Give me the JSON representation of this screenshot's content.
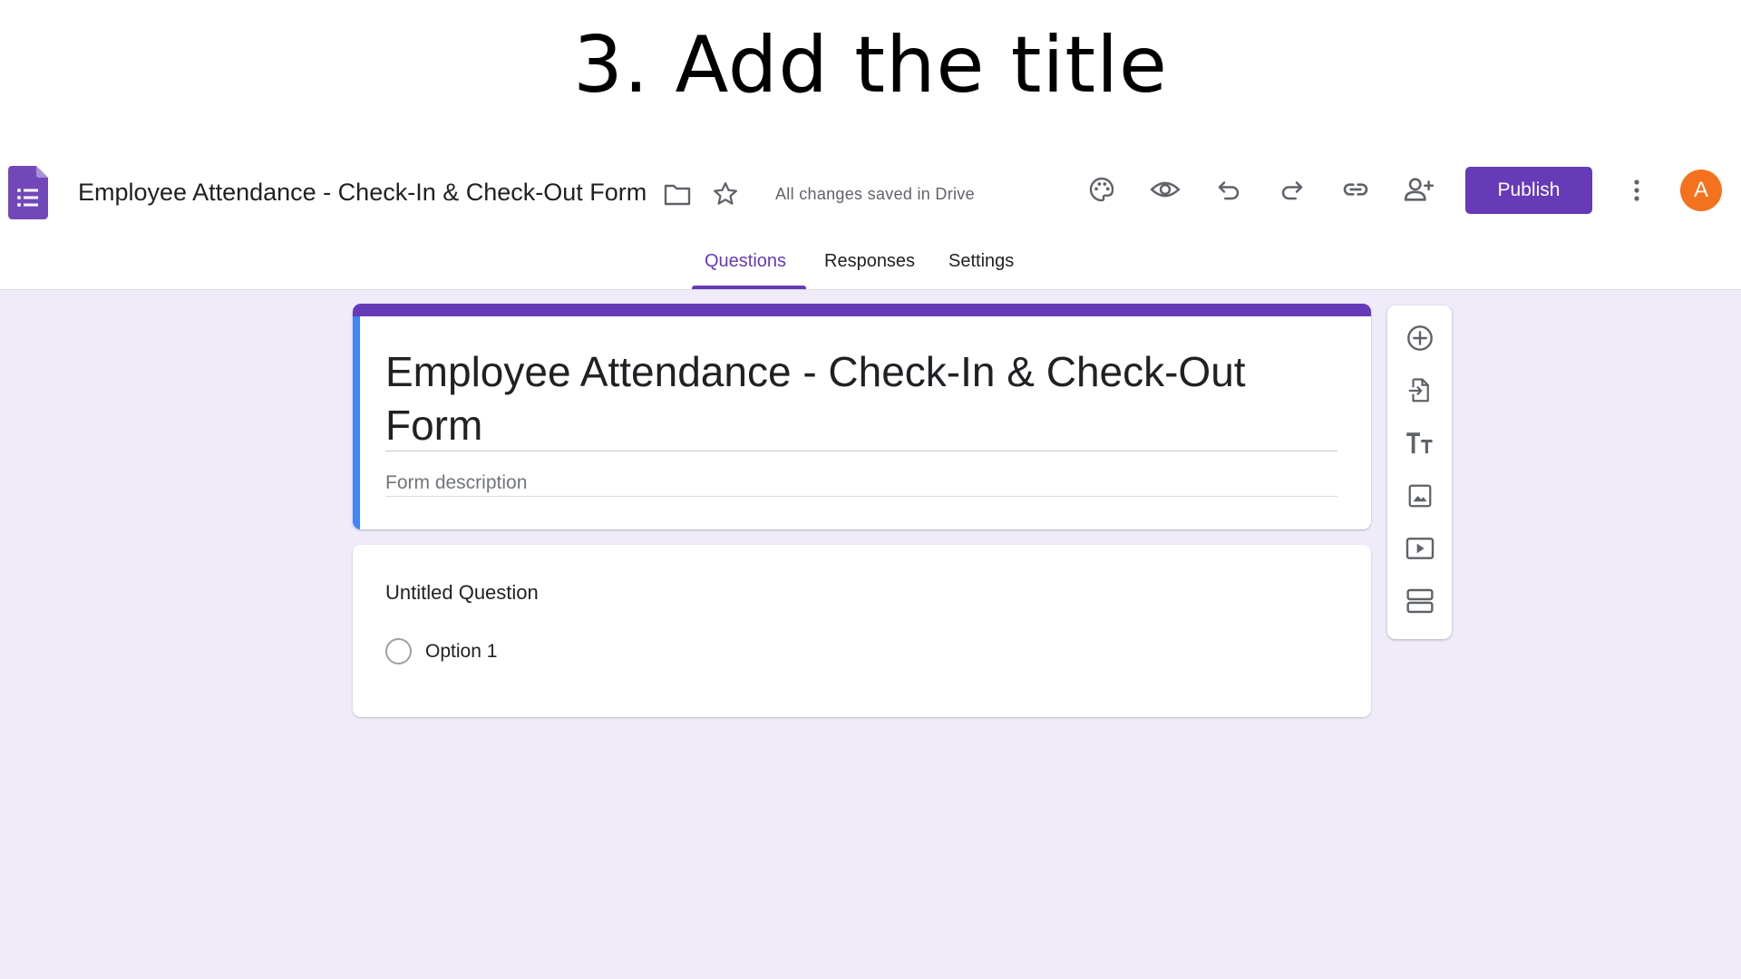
{
  "caption": "3. Add the title",
  "header": {
    "doc_title": "Employee Attendance -  Check-In & Check-Out Form",
    "save_status": "All changes saved in Drive",
    "publish_label": "Publish",
    "avatar_letter": "A",
    "icons": [
      "forms-logo-icon",
      "folder-icon",
      "star-icon",
      "palette-icon",
      "eye-icon",
      "undo-icon",
      "redo-icon",
      "link-icon",
      "add-person-icon",
      "more-vert-icon"
    ]
  },
  "tabs": [
    {
      "label": "Questions",
      "active": true
    },
    {
      "label": "Responses",
      "active": false
    },
    {
      "label": "Settings",
      "active": false
    }
  ],
  "form": {
    "title": "Employee Attendance - Check-In & Check-Out Form",
    "description_placeholder": "Form description"
  },
  "question": {
    "title": "Untitled Question",
    "options": [
      "Option 1"
    ]
  },
  "toolbox": {
    "icons": [
      "add-question-icon",
      "import-questions-icon",
      "title-text-icon",
      "image-icon",
      "video-icon",
      "section-icon"
    ]
  },
  "colors": {
    "accent": "#673ab7",
    "background": "#efebf9",
    "left_accent": "#4285f4",
    "avatar": "#f4711e"
  }
}
